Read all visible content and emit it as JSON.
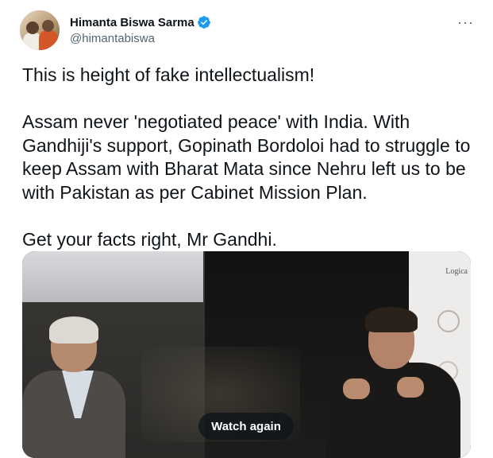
{
  "tweet": {
    "author_name": "Himanta Biswa Sarma",
    "author_handle": "@himantabiswa",
    "more_label": "···",
    "text": "This is height of fake intellectualism!\n\nAssam never 'negotiated peace' with India. With Gandhiji's support, Gopinath Bordoloi had to struggle to keep Assam with Bharat Mata since Nehru left us to be with Pakistan as per Cabinet Mission Plan.\n\nGet your facts right, Mr Gandhi.",
    "media": {
      "banner_text": "Logica",
      "watch_again_label": "Watch again"
    }
  },
  "colors": {
    "verified_badge": "#1d9bf0",
    "handle": "#536471",
    "text": "#0f1419"
  },
  "icons": {
    "verified": "verified-badge-icon",
    "more": "more-options-icon"
  }
}
